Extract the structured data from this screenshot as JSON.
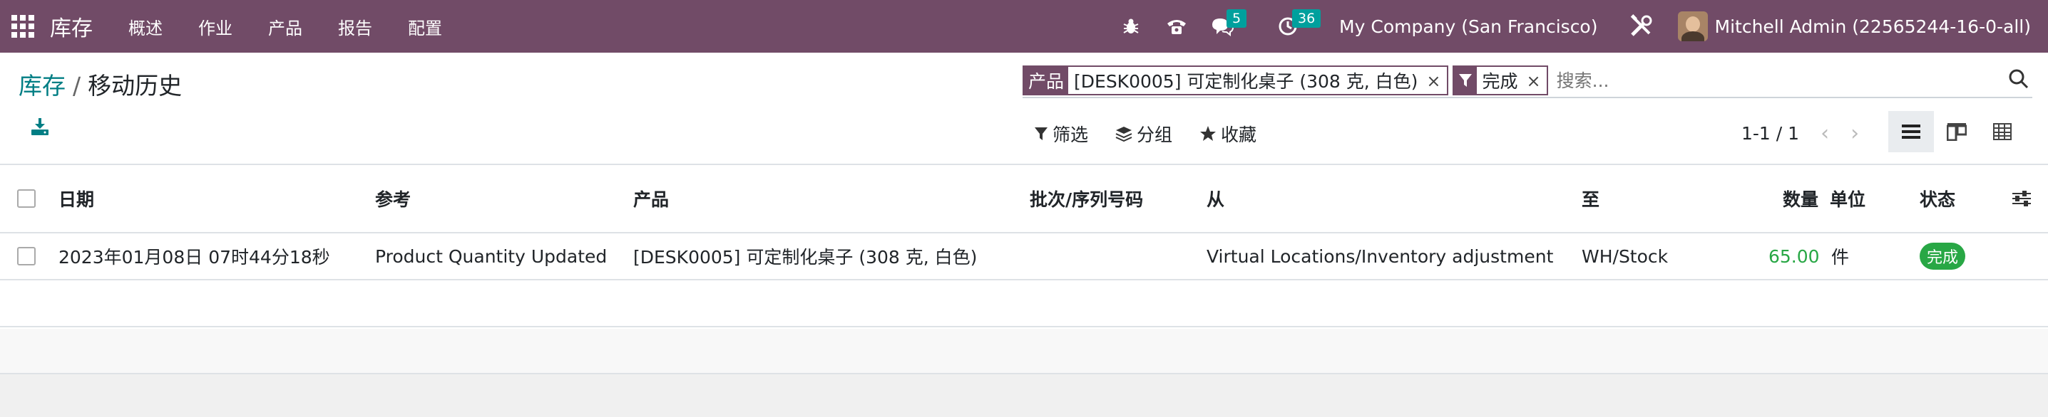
{
  "navbar": {
    "app_name": "库存",
    "menu": [
      "概述",
      "作业",
      "产品",
      "报告",
      "配置"
    ],
    "messages_count": "5",
    "activities_count": "36",
    "company": "My Company (San Francisco)",
    "user": "Mitchell Admin (22565244-16-0-all)"
  },
  "breadcrumb": {
    "parent": "库存",
    "separator": "/",
    "current": "移动历史"
  },
  "search": {
    "facets": [
      {
        "label": "产品",
        "value": "[DESK0005] 可定制化桌子 (308 克, 白色)"
      },
      {
        "label": "filter-icon",
        "value": "完成"
      }
    ],
    "placeholder": "搜索..."
  },
  "filters": {
    "filter_label": "筛选",
    "group_label": "分组",
    "favorite_label": "收藏"
  },
  "pager": {
    "value": "1-1 / 1"
  },
  "table": {
    "headers": [
      "日期",
      "参考",
      "产品",
      "批次/序列号码",
      "从",
      "至",
      "数量",
      "单位",
      "状态"
    ],
    "rows": [
      {
        "date": "2023年01月08日 07时44分18秒",
        "reference": "Product Quantity Updated",
        "product": "[DESK0005] 可定制化桌子 (308 克, 白色)",
        "lot": "",
        "from": "Virtual Locations/Inventory adjustment",
        "to": "WH/Stock",
        "quantity": "65.00",
        "uom": "件",
        "status": "完成"
      }
    ]
  },
  "colors": {
    "brand": "#714b67",
    "link": "#017e84",
    "success": "#28a745",
    "badge": "#00a09d"
  }
}
